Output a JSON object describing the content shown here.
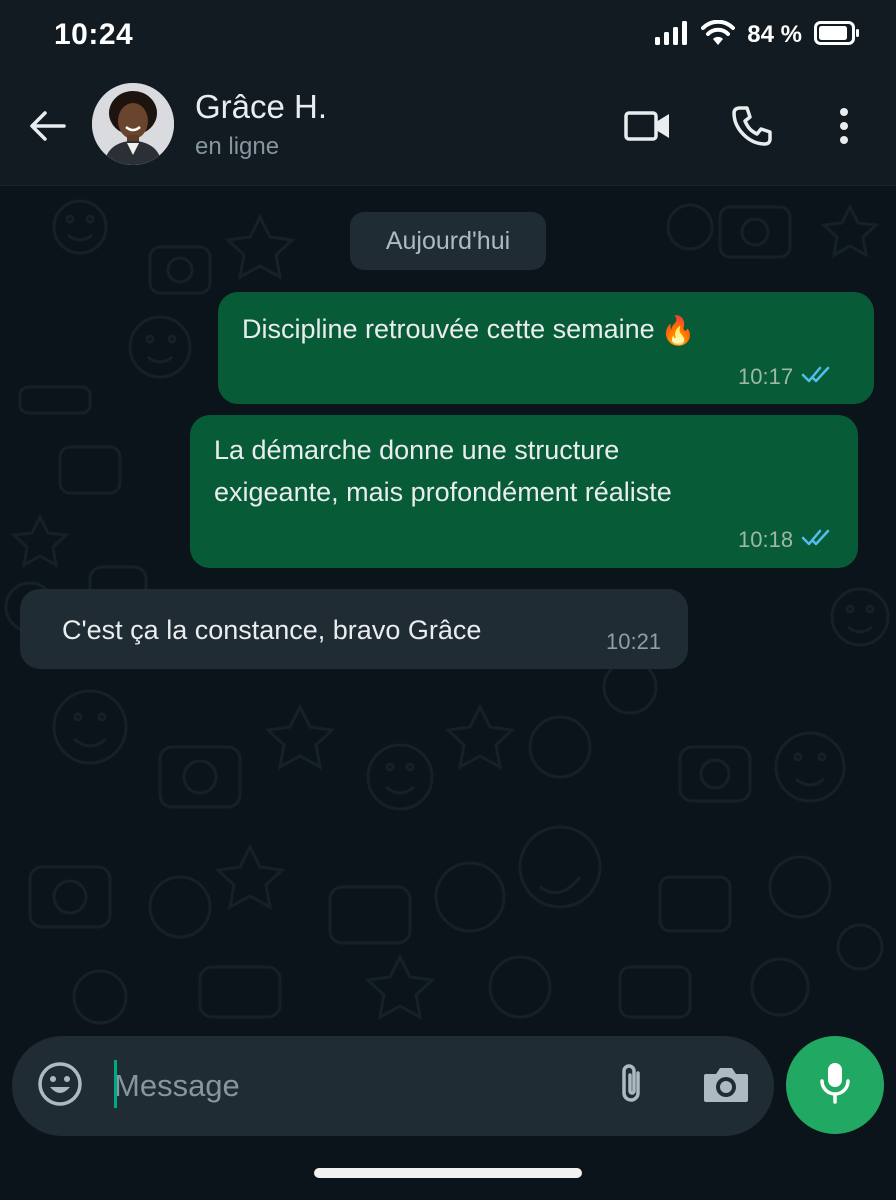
{
  "status_bar": {
    "time": "10:24",
    "battery": "84 %",
    "icons": [
      "signal-icon",
      "wifi-icon",
      "battery-icon"
    ]
  },
  "header": {
    "contact_name": "Grâce H.",
    "contact_status": "en ligne",
    "icons": [
      "back-arrow-icon",
      "video-call-icon",
      "phone-call-icon",
      "more-options-icon"
    ]
  },
  "chat": {
    "date_label": "Aujourd'hui",
    "messages": [
      {
        "direction": "outgoing",
        "text": "Discipline retrouvée cette semaine",
        "emoji": "🔥",
        "time": "10:17",
        "status": "read"
      },
      {
        "direction": "outgoing",
        "lines": [
          "La démarche donne une structure",
          "exigeante, mais profondément réaliste"
        ],
        "time": "10:18",
        "status": "read"
      },
      {
        "direction": "incoming",
        "text": "C'est ça la constance, bravo Grâce",
        "time": "10:21"
      }
    ]
  },
  "composer": {
    "placeholder": "Message",
    "icons": [
      "emoji-icon",
      "attachment-icon",
      "camera-icon",
      "microphone-icon"
    ]
  },
  "colors": {
    "background": "#0b141a",
    "header": "#111b21",
    "outgoing_bubble": "#075b36",
    "incoming_bubble": "#202c33",
    "accent": "#21a964",
    "read_ticks": "#53bdeb"
  }
}
